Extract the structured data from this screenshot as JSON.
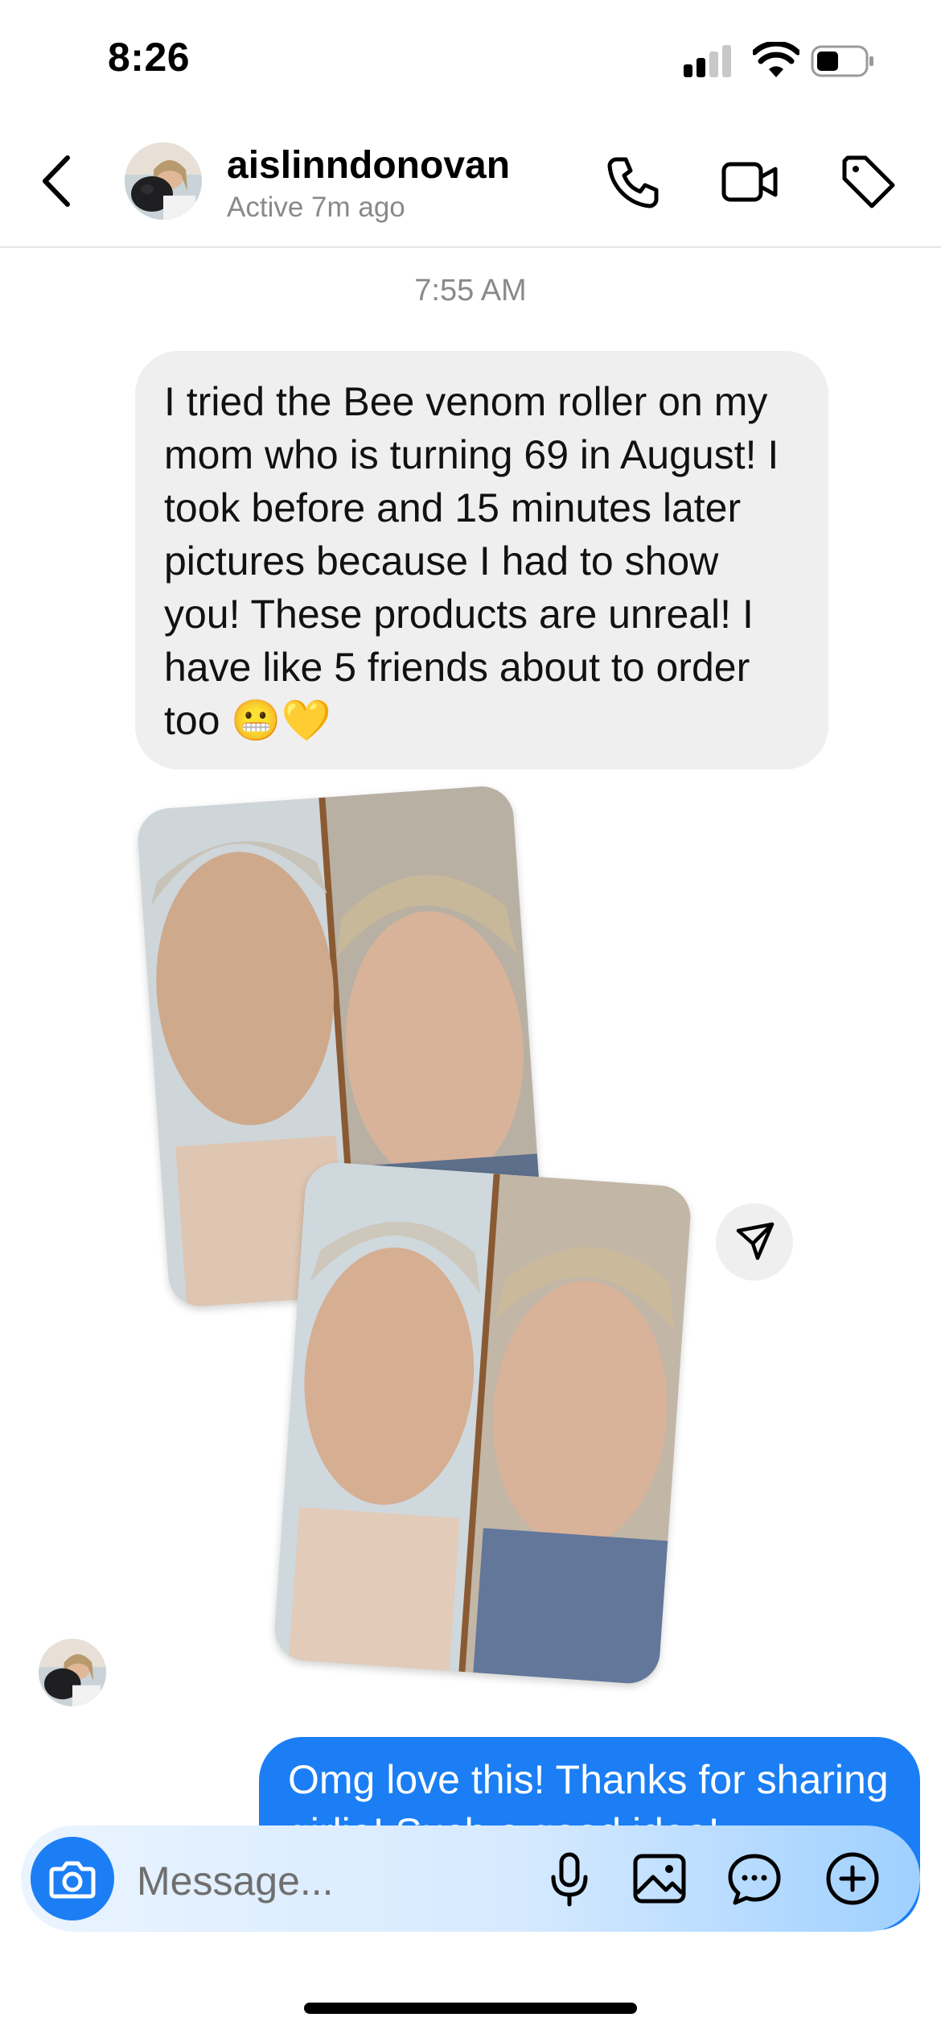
{
  "status_bar": {
    "time": "8:26"
  },
  "header": {
    "username": "aislinndonovan",
    "status": "Active 7m ago"
  },
  "thread": {
    "timestamp": "7:55 AM",
    "incoming_message": "I tried the Bee venom roller on my mom who is turning 69 in August! I took before and 15 minutes later pictures because I had to show you! These products are unreal! I have like 5 friends about to order too 😬💛",
    "outgoing_message": "Omg love this! Thanks for sharing girlie! Such a good idea!"
  },
  "composer": {
    "placeholder": "Message..."
  },
  "icons": {
    "back": "chevron-left-icon",
    "call": "phone-icon",
    "video": "video-camera-icon",
    "tag": "tag-icon",
    "share": "send-icon",
    "camera": "camera-icon",
    "mic": "microphone-icon",
    "gallery": "image-icon",
    "sticker": "chat-bubble-icon",
    "more": "plus-icon"
  },
  "colors": {
    "accent": "#1b7ef4",
    "incoming_bubble": "#efefef",
    "muted_text": "#8a8a8a"
  }
}
